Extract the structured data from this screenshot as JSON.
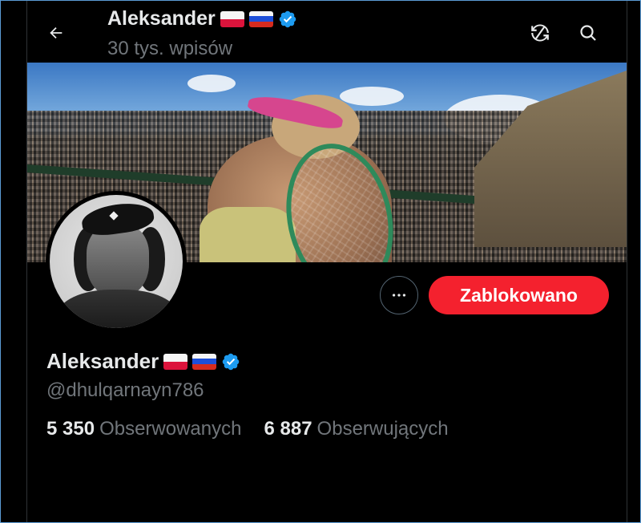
{
  "header": {
    "name": "Aleksander",
    "posts_count": "30 tys. wpisów",
    "icons": [
      "back-arrow-icon",
      "refresh-icon",
      "search-icon"
    ]
  },
  "profile": {
    "name": "Aleksander",
    "handle": "@dhulqarnayn786",
    "flags": [
      "poland-flag",
      "russia-flag"
    ],
    "verified": true,
    "following_count": "5 350",
    "following_label": "Obserwowanych",
    "followers_count": "6 887",
    "followers_label": "Obserwujących"
  },
  "actions": {
    "more_label": "···",
    "blocked_label": "Zablokowano"
  },
  "colors": {
    "background": "#000000",
    "text_primary": "#e7e9ea",
    "text_secondary": "#71767b",
    "blocked_red": "#f4212e",
    "verified_blue": "#1d9bf0"
  }
}
